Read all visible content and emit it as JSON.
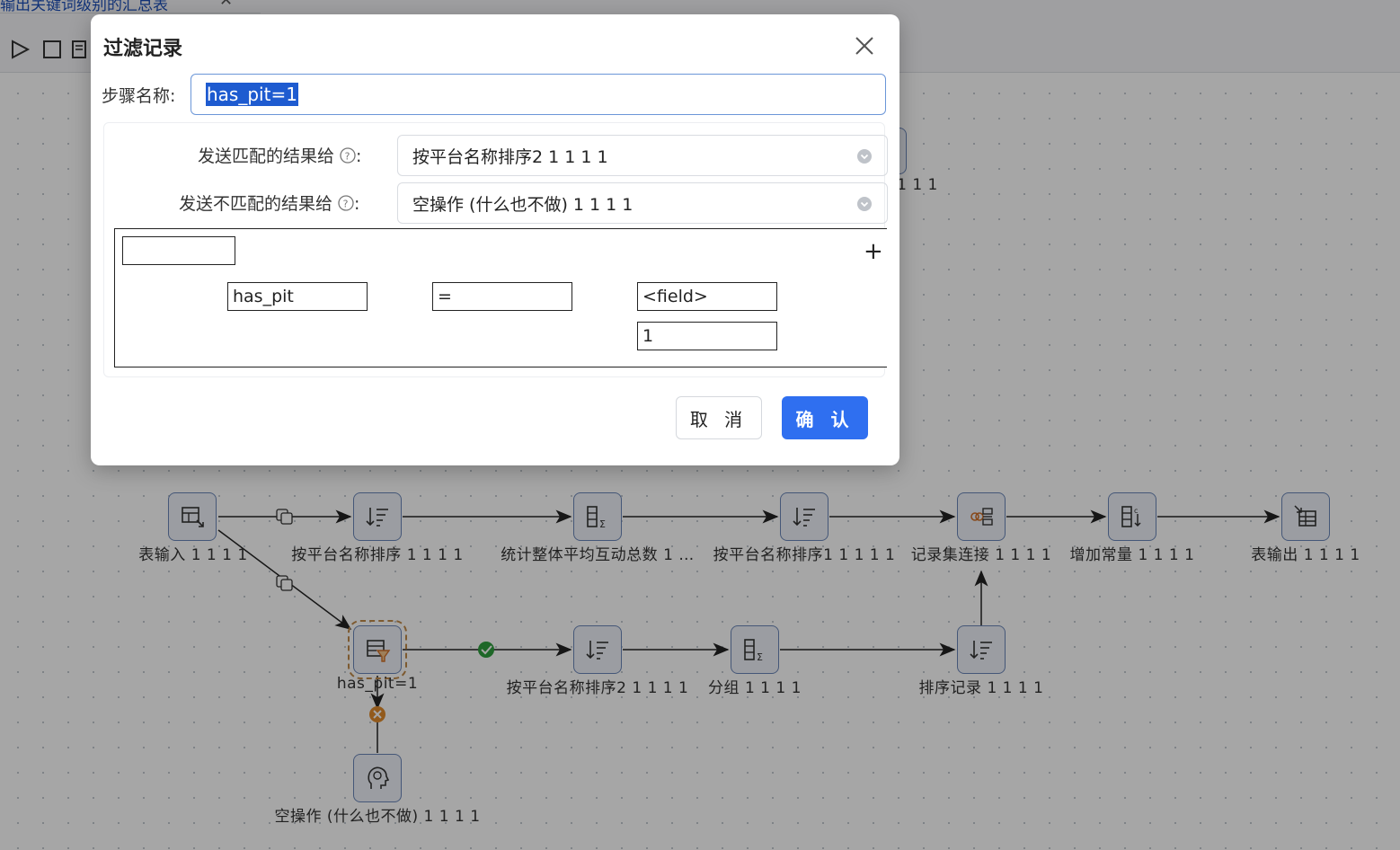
{
  "tab": {
    "title": "输出关键词级别的汇总表",
    "close": "✕"
  },
  "canvas": {
    "nodes": [
      {
        "id": "table-input",
        "label": "表输入 1 1 1 1"
      },
      {
        "id": "sort-platform",
        "label": "按平台名称排序 1 1 1 1"
      },
      {
        "id": "stats-avg",
        "label": "统计整体平均互动总数 1 …"
      },
      {
        "id": "sort-platform-1",
        "label": "按平台名称排序1 1 1 1 1"
      },
      {
        "id": "merge-join",
        "label": "记录集连接 1 1 1 1"
      },
      {
        "id": "add-constant",
        "label": "增加常量 1 1 1 1"
      },
      {
        "id": "table-output",
        "label": "表输出 1 1 1 1"
      },
      {
        "id": "filter",
        "label": "has_pit=1"
      },
      {
        "id": "sort-platform-2",
        "label": "按平台名称排序2 1 1 1 1"
      },
      {
        "id": "group",
        "label": "分组 1 1 1 1"
      },
      {
        "id": "sort-rows",
        "label": "排序记录 1 1 1 1"
      },
      {
        "id": "dummy",
        "label": "空操作 (什么也不做) 1 1 1 1"
      }
    ],
    "partial_labels": {
      "right_mid": "1 1 1"
    }
  },
  "dialog": {
    "title": "过滤记录",
    "step_name_label": "步骤名称:",
    "step_name_value": "has_pit=1",
    "send_true_label": "发送匹配的结果给",
    "send_true_value": "按平台名称排序2 1 1 1 1",
    "send_false_label": "发送不匹配的结果给",
    "send_false_value": "空操作 (什么也不做) 1 1 1 1",
    "colon": ":",
    "condition": {
      "field": "has_pit",
      "operator": "=",
      "value_type": "<field>",
      "value": "1",
      "add_symbol": "+"
    },
    "cancel_label": "取 消",
    "ok_label": "确 认"
  },
  "colors": {
    "primary": "#2f6ff0",
    "node_border": "#6b86b8",
    "true_hop": "#2e9e3e",
    "false_hop": "#e08a2c"
  }
}
